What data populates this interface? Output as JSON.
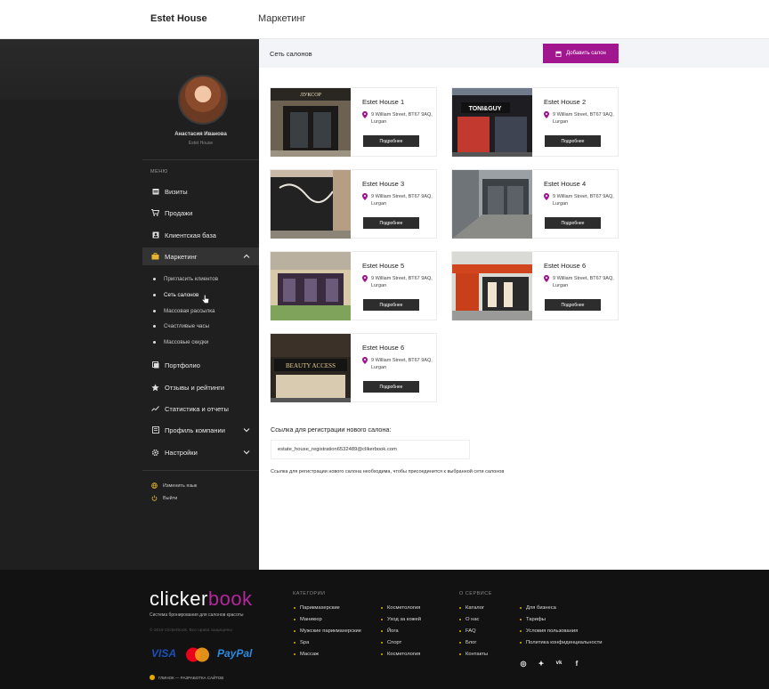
{
  "header": {
    "brand": "Estet House",
    "section": "Маркетинг"
  },
  "profile": {
    "name": "Анастасия Иванова",
    "salon": "Estet House"
  },
  "menu": {
    "caption": "МЕНЮ",
    "items": [
      {
        "label": "Визиты",
        "icon": "calendar-icon"
      },
      {
        "label": "Продажи",
        "icon": "cart-icon"
      },
      {
        "label": "Клиентская база",
        "icon": "contacts-icon"
      },
      {
        "label": "Маркетинг",
        "icon": "briefcase-icon"
      },
      {
        "label": "Портфолио",
        "icon": "gallery-icon"
      },
      {
        "label": "Отзывы и рейтинги",
        "icon": "star-icon"
      },
      {
        "label": "Статистика и отчеты",
        "icon": "chart-icon"
      },
      {
        "label": "Профиль компании",
        "icon": "profile-icon"
      },
      {
        "label": "Настройки",
        "icon": "gear-icon"
      }
    ],
    "submenu": [
      "Пригласить клиентов",
      "Сеть салонов",
      "Массовая рассылка",
      "Счастливые часы",
      "Массовые скидки"
    ],
    "utilities": [
      {
        "label": "Изменить язык",
        "icon": "globe-icon"
      },
      {
        "label": "Выйти",
        "icon": "power-icon"
      }
    ]
  },
  "content": {
    "title": "Сеть салонов",
    "add_button": "Добавить салон",
    "more_label": "Подробнее",
    "salons": [
      {
        "name": "Estet House 1",
        "address": "9 William Street, BT67 9AQ, Lurgan",
        "photo_sign": "ЛУКСОР"
      },
      {
        "name": "Estet House 2",
        "address": "9 William Street, BT67 9AQ, Lurgan",
        "photo_sign": "TONI&GUY"
      },
      {
        "name": "Estet House 3",
        "address": "9 William Street, BT67 9AQ, Lurgan",
        "photo_sign": ""
      },
      {
        "name": "Estet House 4",
        "address": "9 William Street, BT67 9AQ, Lurgan",
        "photo_sign": ""
      },
      {
        "name": "Estet House 5",
        "address": "9 William Street, BT67 9AQ, Lurgan",
        "photo_sign": ""
      },
      {
        "name": "Estet House 6",
        "address": "9 William Street, BT67 9AQ, Lurgan",
        "photo_sign": ""
      },
      {
        "name": "Estet House 6",
        "address": "9 William Street, BT67 9AQ, Lurgan",
        "photo_sign": "BEAUTY ACCESS"
      }
    ],
    "registration": {
      "label": "Ссылка для регистрации нового салона:",
      "value": "estate_house_registration6532489@clikerbook.com",
      "hint": "Ссылка для регистрации нового салона необходима, чтобы присоединится к выбранной сети салонов"
    }
  },
  "footer": {
    "logo_main": "clicker",
    "logo_accent": "book",
    "tagline": "Система бронирования для салонов красоты",
    "copyright": "© 2019 Clickerbook. Все права защищены",
    "payments": [
      "VISA",
      "PayPal"
    ],
    "developer": "ГЛИНОК — РАЗРАБОТКА САЙТОВ",
    "categories_caption": "КАТЕГОРИИ",
    "categories_col1": [
      "Парикмахерские",
      "Маникюр",
      "Мужские парикмахерские",
      "Spa",
      "Массаж"
    ],
    "categories_col2": [
      "Косметология",
      "Уход за кожей",
      "Йога",
      "Спорт",
      "Косметология"
    ],
    "service_caption": "О СЕРВИСЕ",
    "service_col1": [
      "Каталог",
      "О нас",
      "FAQ",
      "Блог",
      "Контакты"
    ],
    "service_col2": [
      "Для бизнеса",
      "Тарифы",
      "Условия пользования",
      "Политика конфиденциальности"
    ],
    "social": [
      {
        "icon": "instagram-icon",
        "glyph": "◎"
      },
      {
        "icon": "twitter-icon",
        "glyph": "✦"
      },
      {
        "icon": "vk-icon",
        "glyph": "vk"
      },
      {
        "icon": "facebook-icon",
        "glyph": "f"
      }
    ]
  },
  "colors": {
    "accent": "#a1158e",
    "sidebar": "#1f1f1f",
    "footer": "#121212"
  }
}
